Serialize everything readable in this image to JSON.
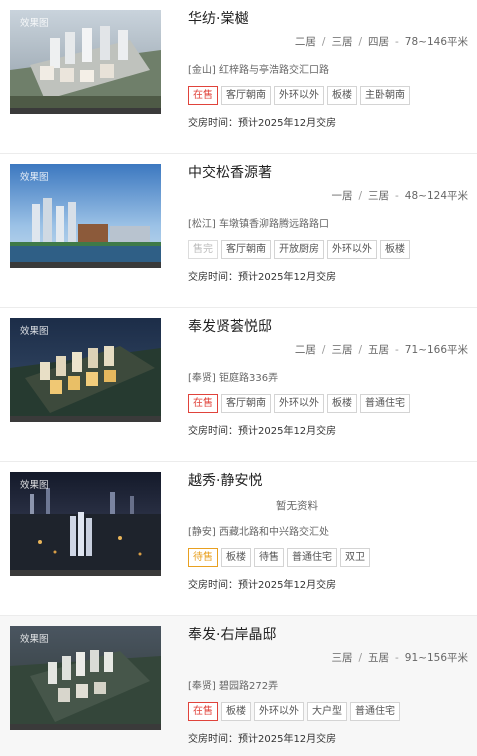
{
  "listings": [
    {
      "name": "华纺·棠樾",
      "rooms": [
        "二居",
        "三居",
        "四居"
      ],
      "area": "78~146平米",
      "address": "[金山] 红梓路与亭浩路交汇口路",
      "status": {
        "label": "在售",
        "style": "red"
      },
      "tags": [
        "客厅朝南",
        "外环以外",
        "板楼",
        "主卧朝南"
      ],
      "delivery": "交房时间：预计2025年12月交房",
      "watermark": "效果图"
    },
    {
      "name": "中交松香源著",
      "rooms": [
        "一居",
        "三居"
      ],
      "area": "48~124平米",
      "address": "[松江] 车墩镇香泖路腾远路路口",
      "status": {
        "label": "售完",
        "style": "gray"
      },
      "tags": [
        "客厅朝南",
        "开放厨房",
        "外环以外",
        "板楼"
      ],
      "delivery": "交房时间：预计2025年12月交房",
      "watermark": "效果图"
    },
    {
      "name": "奉发贤荟悦邸",
      "rooms": [
        "二居",
        "三居",
        "五居"
      ],
      "area": "71~166平米",
      "address": "[奉贤] 钜庭路336弄",
      "status": {
        "label": "在售",
        "style": "red"
      },
      "tags": [
        "客厅朝南",
        "外环以外",
        "板楼",
        "普通住宅"
      ],
      "delivery": "交房时间：预计2025年12月交房",
      "watermark": "效果图"
    },
    {
      "name": "越秀·静安悦",
      "no_data": "暂无资料",
      "address": "[静安] 西藏北路和中兴路交汇处",
      "status": {
        "label": "待售",
        "style": "orange"
      },
      "tags": [
        "板楼",
        "待售",
        "普通住宅",
        "双卫"
      ],
      "delivery": "交房时间：预计2025年12月交房",
      "watermark": "效果图"
    },
    {
      "name": "奉发·右岸晶邸",
      "rooms": [
        "三居",
        "五居"
      ],
      "area": "91~156平米",
      "address": "[奉贤] 碧园路272弄",
      "status": {
        "label": "在售",
        "style": "red"
      },
      "tags": [
        "板楼",
        "外环以外",
        "大户型",
        "普通住宅"
      ],
      "delivery": "交房时间：预计2025年12月交房",
      "watermark": "效果图"
    }
  ]
}
